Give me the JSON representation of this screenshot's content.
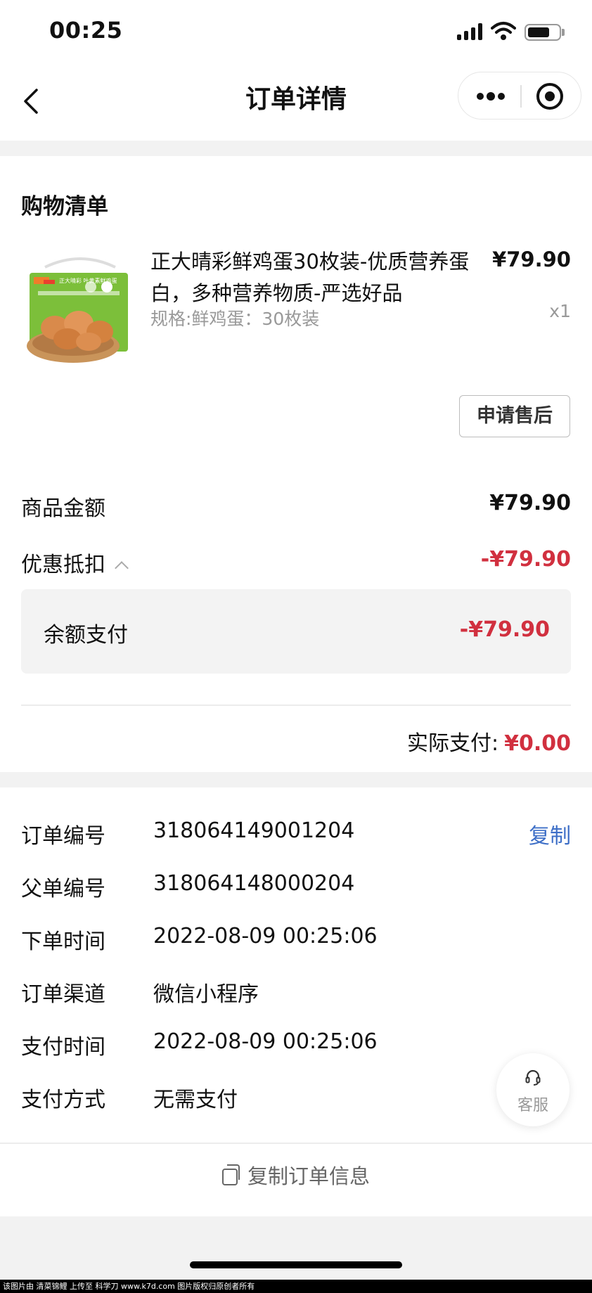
{
  "status_bar": {
    "time": "00:25"
  },
  "nav": {
    "title": "订单详情"
  },
  "shopping": {
    "section_title": "购物清单",
    "product": {
      "name": "正大晴彩鲜鸡蛋30枚装-优质营养蛋白，多种营养物质-严选好品",
      "spec": "规格:鲜鸡蛋：30枚装",
      "price": "¥79.90",
      "qty": "x1",
      "box_text": "正大晴彩 叶黄素鲜鸡蛋"
    },
    "after_sale_label": "申请售后"
  },
  "amounts": {
    "goods_label": "商品金额",
    "goods_value": "¥79.90",
    "discount_label": "优惠抵扣",
    "discount_value": "-¥79.90",
    "balance_label": "余额支付",
    "balance_value": "-¥79.90",
    "actual_label": "实际支付:",
    "actual_value": "¥0.00"
  },
  "order_info": {
    "rows": [
      {
        "label": "订单编号",
        "value": "318064149001204"
      },
      {
        "label": "父单编号",
        "value": "318064148000204"
      },
      {
        "label": "下单时间",
        "value": "2022-08-09 00:25:06"
      },
      {
        "label": "订单渠道",
        "value": "微信小程序"
      },
      {
        "label": "支付时间",
        "value": "2022-08-09 00:25:06"
      },
      {
        "label": "支付方式",
        "value": "无需支付"
      }
    ],
    "copy_label": "复制",
    "copy_order_label": "复制订单信息"
  },
  "service": {
    "label": "客服"
  },
  "watermark": "该图片由 清菜锦鲤 上传至 科学刀 www.k7d.com 图片版权归原创者所有",
  "colors": {
    "accent_red": "#d1303f",
    "link_blue": "#3e6fc7"
  }
}
